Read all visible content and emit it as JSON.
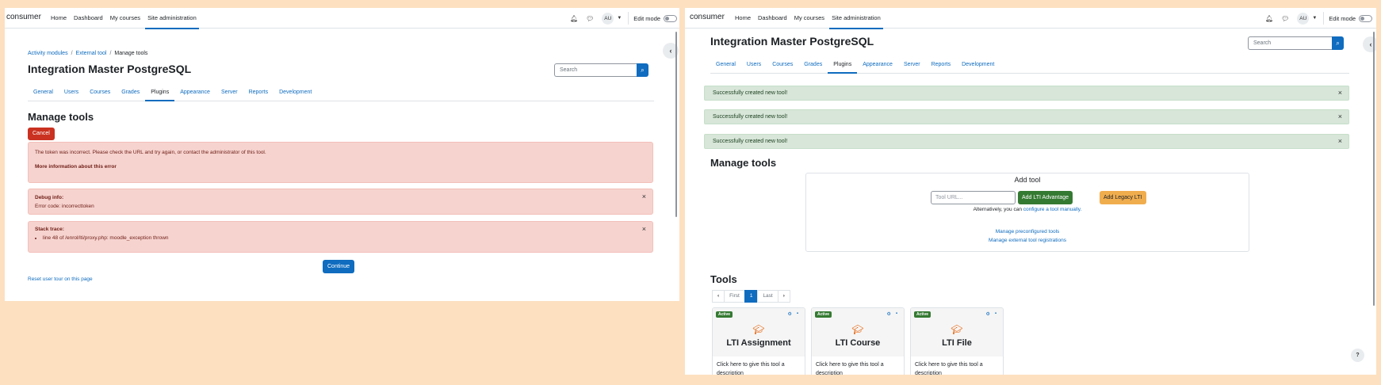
{
  "left": {
    "navbar": {
      "brand": "consumer",
      "links": [
        "Home",
        "Dashboard",
        "My courses",
        "Site administration"
      ],
      "avatar": "AU",
      "edit_mode": "Edit mode"
    },
    "breadcrumb": [
      "Activity modules",
      "External tool",
      "Manage tools"
    ],
    "site_title": "Integration Master PostgreSQL",
    "search_placeholder": "Search",
    "tabs": [
      "General",
      "Users",
      "Courses",
      "Grades",
      "Plugins",
      "Appearance",
      "Server",
      "Reports",
      "Development"
    ],
    "heading": "Manage tools",
    "cancel_label": "Cancel",
    "error": {
      "message": "The token was incorrect. Please check the URL and try again, or contact the administrator of this tool.",
      "more_info": "More information about this error"
    },
    "debug": {
      "title": "Debug info:",
      "code": "Error code: incorrecttoken"
    },
    "stack": {
      "title": "Stack trace:",
      "item": "line 48 of /enrol/lti/proxy.php: moodle_exception thrown"
    },
    "continue_label": "Continue",
    "reset_tour": "Reset user tour on this page"
  },
  "right": {
    "navbar": {
      "brand": "consumer",
      "links": [
        "Home",
        "Dashboard",
        "My courses",
        "Site administration"
      ],
      "avatar": "AU",
      "edit_mode": "Edit mode"
    },
    "site_title": "Integration Master PostgreSQL",
    "search_placeholder": "Search",
    "tabs": [
      "General",
      "Users",
      "Courses",
      "Grades",
      "Plugins",
      "Appearance",
      "Server",
      "Reports",
      "Development"
    ],
    "notifications": [
      "Successfully created new tool!",
      "Successfully created new tool!",
      "Successfully created new tool!"
    ],
    "heading": "Manage tools",
    "add_tool": {
      "title": "Add tool",
      "url_placeholder": "Tool URL...",
      "lti_advantage": "Add LTI Advantage",
      "legacy_lti": "Add Legacy LTI",
      "alternatively": "Alternatively, you can",
      "configure_link": "configure a tool manually.",
      "preconfigured": "Manage preconfigured tools",
      "registrations": "Manage external tool registrations"
    },
    "tools_heading": "Tools",
    "pagination": {
      "first": "First",
      "current": "1",
      "last": "Last"
    },
    "cards": [
      {
        "status": "Active",
        "name": "LTI Assignment",
        "desc_1": "Click here to give this tool a",
        "desc_2": "description"
      },
      {
        "status": "Active",
        "name": "LTI Course",
        "desc_1": "Click here to give this tool a",
        "desc_2": "description"
      },
      {
        "status": "Active",
        "name": "LTI File",
        "desc_1": "Click here to give this tool a",
        "desc_2": "description"
      }
    ],
    "help_label": "?"
  }
}
